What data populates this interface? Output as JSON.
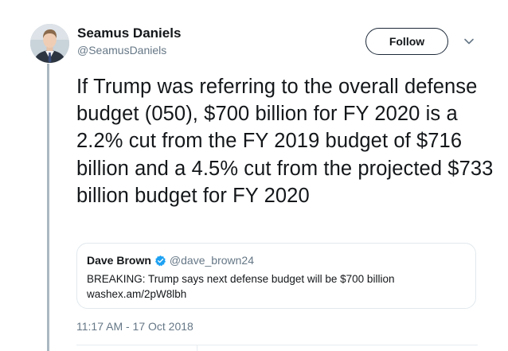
{
  "tweet": {
    "author": {
      "display_name": "Seamus Daniels",
      "handle": "@SeamusDaniels",
      "avatar_icon": "profile-photo"
    },
    "follow_label": "Follow",
    "menu_icon": "chevron-down-icon",
    "text": "If Trump was referring to the overall defense budget (050), $700 billion for FY 2020 is a 2.2% cut from the FY 2019 budget of $716 billion and a 4.5% cut from the projected $733 billion budget for FY 2020",
    "timestamp": "11:17 AM - 17 Oct 2018"
  },
  "quoted_tweet": {
    "author_name": "Dave Brown",
    "verified": true,
    "verified_icon": "verified-badge-icon",
    "handle": "@dave_brown24",
    "text": "BREAKING: Trump says next defense budget will be $700 billion",
    "link": "washex.am/2pW8lbh"
  },
  "colors": {
    "text_primary": "#14171a",
    "text_secondary": "#657786",
    "verified_blue": "#1da1f2",
    "border": "#e1e8ed",
    "thread_line": "#aab8c2"
  }
}
